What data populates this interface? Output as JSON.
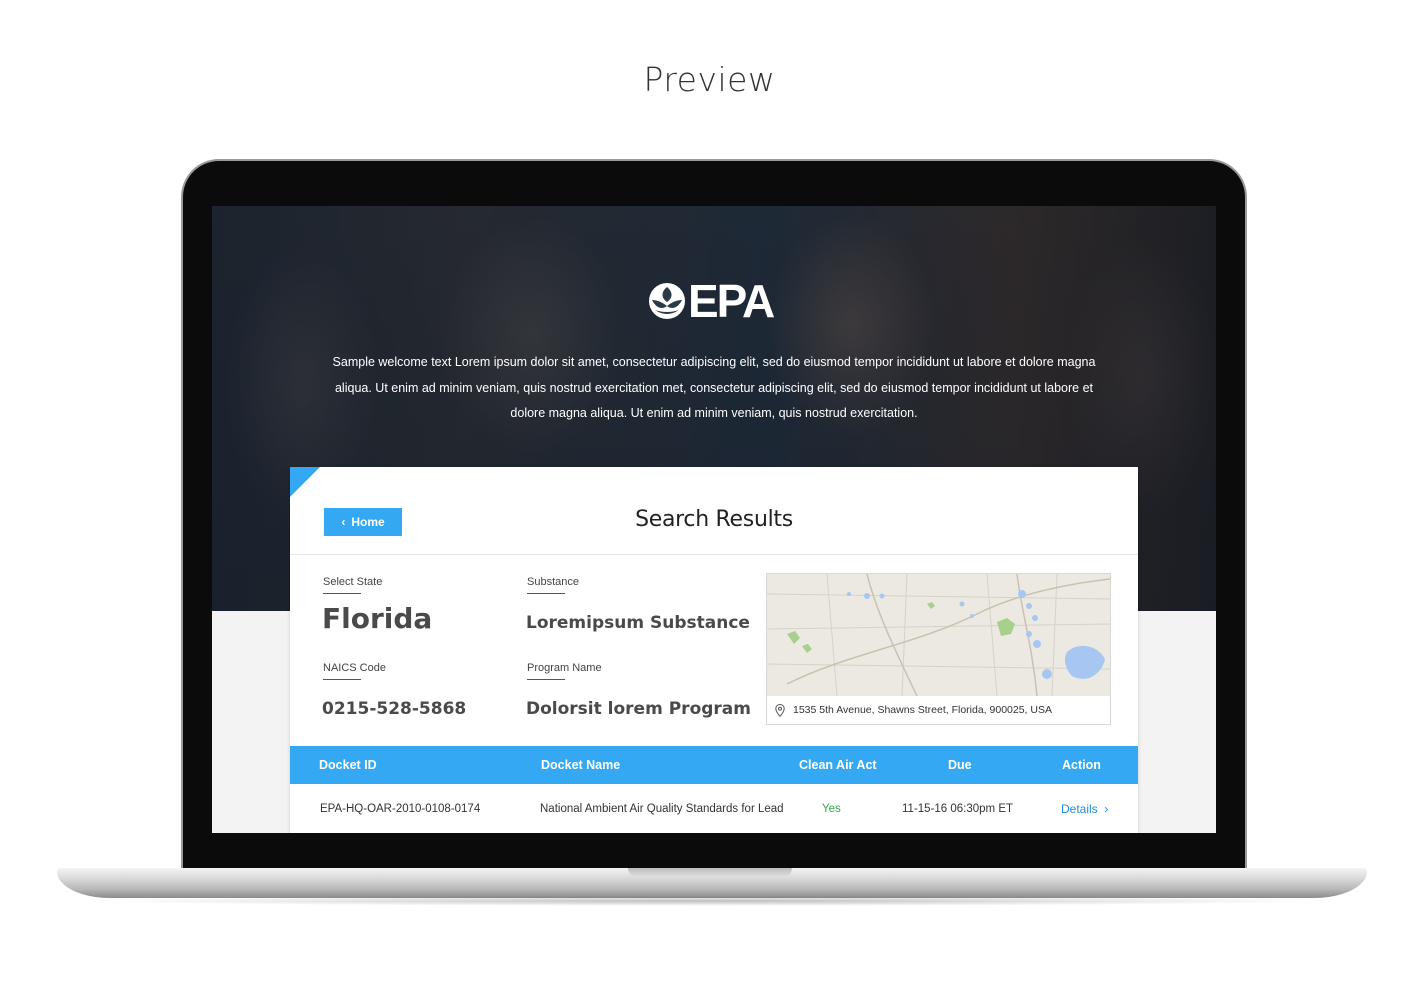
{
  "preview_title": "Preview",
  "brand": {
    "logo_text": "EPA",
    "accent": "#35a8f4"
  },
  "hero": {
    "welcome_text": "Sample welcome text Lorem ipsum dolor sit amet, consectetur adipiscing elit, sed do eiusmod tempor incididunt ut labore et dolore magna aliqua. Ut enim ad minim veniam, quis nostrud exercitation met, consectetur adipiscing elit, sed do eiusmod tempor incididunt ut labore et dolore magna aliqua. Ut enim ad minim veniam, quis nostrud exercitation."
  },
  "card": {
    "home_label": "Home",
    "title": "Search Results"
  },
  "fields": {
    "state_label": "Select State",
    "state_value": "Florida",
    "substance_label": "Substance",
    "substance_value": "Loremipsum Substance",
    "naics_label": "NAICS Code",
    "naics_value": "0215-528-5868",
    "program_label": "Program Name",
    "program_value": "Dolorsit lorem Program"
  },
  "map": {
    "address": "1535 5th Avenue, Shawns Street, Florida, 900025, USA",
    "icon": "location-pin-icon"
  },
  "table": {
    "headers": {
      "docket_id": "Docket ID",
      "docket_name": "Docket Name",
      "clean_air_act": "Clean Air Act",
      "due": "Due",
      "action": "Action"
    },
    "rows": [
      {
        "docket_id": "EPA-HQ-OAR-2010-0108-0174",
        "docket_name": "National Ambient Air Quality Standards for Lead",
        "clean_air_act": "Yes",
        "due": "11-15-16 06:30pm ET",
        "action": "Details"
      }
    ]
  }
}
